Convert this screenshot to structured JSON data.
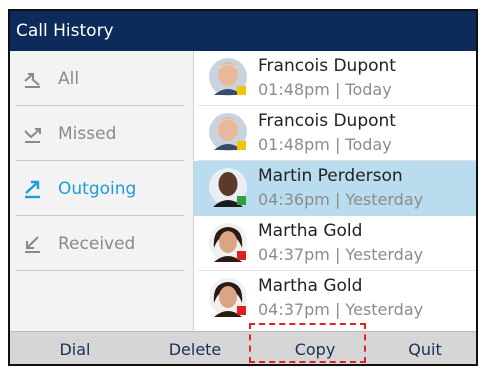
{
  "header": {
    "title": "Call History"
  },
  "sidebar": {
    "items": [
      {
        "label": "All",
        "icon": "all-calls-icon",
        "active": false
      },
      {
        "label": "Missed",
        "icon": "missed-call-icon",
        "active": false
      },
      {
        "label": "Outgoing",
        "icon": "outgoing-call-icon",
        "active": true
      },
      {
        "label": "Received",
        "icon": "received-call-icon",
        "active": false
      }
    ]
  },
  "calls": [
    {
      "name": "Francois Dupont",
      "time": "01:48pm | Today",
      "status": "away",
      "status_color": "#f5c400",
      "selected": false
    },
    {
      "name": "Francois Dupont",
      "time": "01:48pm | Today",
      "status": "away",
      "status_color": "#f5c400",
      "selected": false
    },
    {
      "name": "Martin Perderson",
      "time": "04:36pm | Yesterday",
      "status": "available",
      "status_color": "#2ea043",
      "selected": true
    },
    {
      "name": "Martha Gold",
      "time": "04:37pm | Yesterday",
      "status": "busy",
      "status_color": "#e02020",
      "selected": false
    },
    {
      "name": "Martha Gold",
      "time": "04:37pm | Yesterday",
      "status": "busy",
      "status_color": "#e02020",
      "selected": false
    }
  ],
  "softkeys": {
    "dial": "Dial",
    "delete": "Delete",
    "copy": "Copy",
    "quit": "Quit"
  },
  "colors": {
    "titlebar": "#0d2a5b",
    "accent": "#1e9cd7",
    "selected_row": "#b9dcef",
    "highlight_box": "#e52020"
  }
}
